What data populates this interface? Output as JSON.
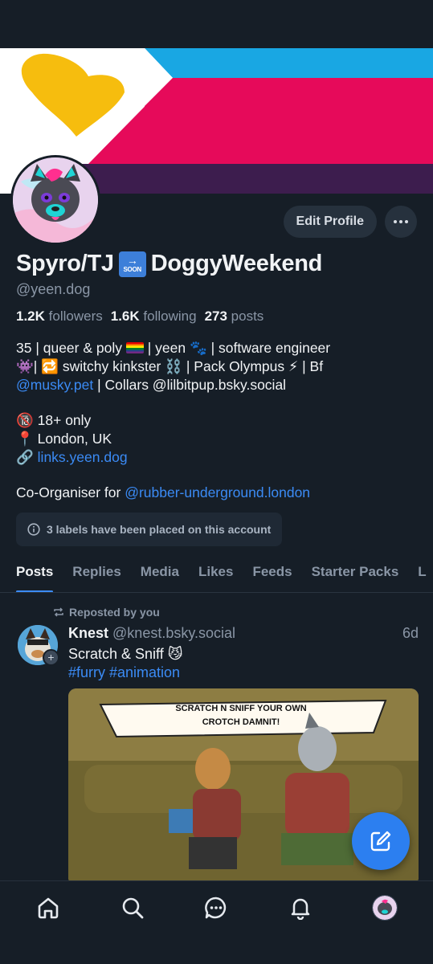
{
  "profile": {
    "display_name": "Spyro/TJ",
    "display_name_suffix": "DoggyWeekend",
    "soon_badge": "SOON",
    "handle": "@yeen.dog",
    "edit_profile_label": "Edit Profile",
    "stats": {
      "followers_count": "1.2K",
      "followers_label": "followers",
      "following_count": "1.6K",
      "following_label": "following",
      "posts_count": "273",
      "posts_label": "posts"
    },
    "bio": {
      "line1_a": "35 | queer & poly ",
      "line1_b": " | yeen 🐾 | software engineer",
      "line2": "👾| 🔁 switchy kinkster ⛓️ | Pack Olympus ⚡ | Bf",
      "line3_link": "@musky.pet",
      "line3_rest": " | Collars @lilbitpup.bsky.social",
      "line4": "🔞 18+ only",
      "line5": "📍 London, UK",
      "line6_icon": "🔗",
      "line6_link": "links.yeen.dog",
      "line7_prefix": "Co-Organiser for ",
      "line7_link": "@rubber-underground.london"
    },
    "labels_notice": "3 labels have been placed on this account"
  },
  "tabs": [
    "Posts",
    "Replies",
    "Media",
    "Likes",
    "Feeds",
    "Starter Packs",
    "L"
  ],
  "active_tab": "Posts",
  "post": {
    "repost_label": "Reposted by you",
    "author": "Knest",
    "author_handle": "@knest.bsky.social",
    "time": "6d",
    "text": "Scratch & Sniff 😼",
    "tags": "#furry #animation",
    "image_caption": "SCRATCH N SNIFF YOUR OWN CROTCH DAMNIT!",
    "image_caption_line1": "SCRATCH N SNIFF YOUR OWN",
    "image_caption_line2": "CROTCH DAMNIT!"
  },
  "bottom_nav": [
    "home-icon",
    "search-icon",
    "chat-icon",
    "bell-icon",
    "profile-avatar"
  ],
  "colors": {
    "background": "#161e27",
    "accent": "#3b8bf5",
    "fab": "#2c7ff0",
    "banner_cyan": "#19a7e3",
    "banner_magenta": "#e60a5a",
    "banner_purple": "#3d1d4e",
    "banner_yellow": "#f6bd0e"
  }
}
